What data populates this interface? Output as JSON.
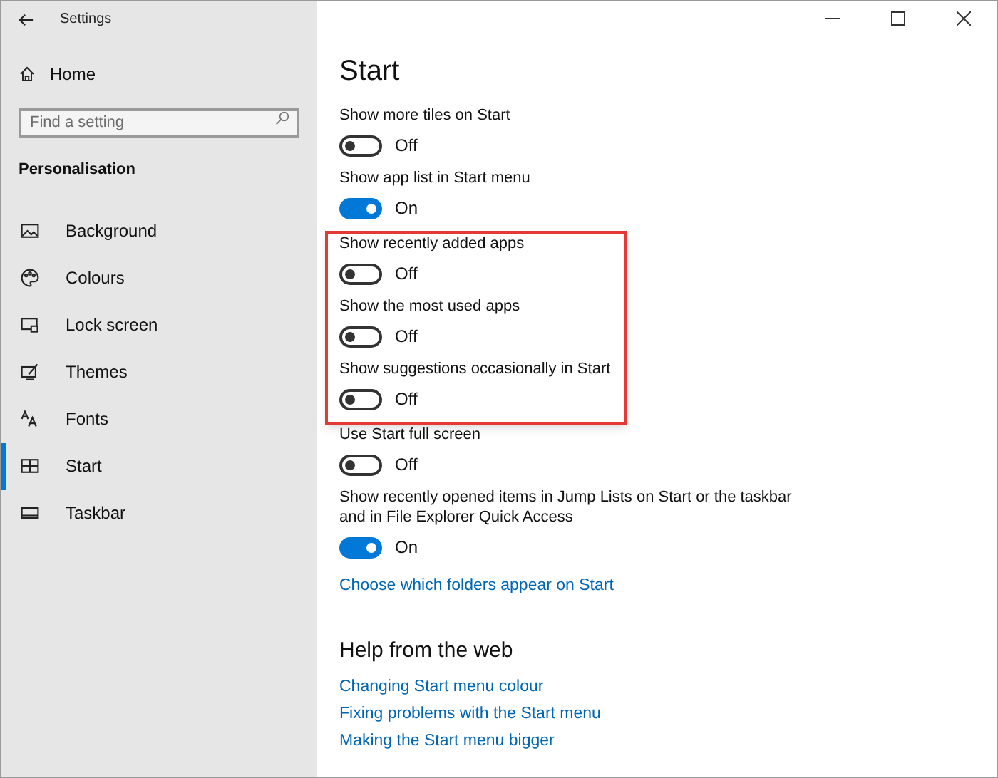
{
  "window": {
    "title": "Settings"
  },
  "sidebar": {
    "home": "Home",
    "search": {
      "placeholder": "Find a setting"
    },
    "section": "Personalisation",
    "items": [
      {
        "label": "Background",
        "selected": false
      },
      {
        "label": "Colours",
        "selected": false
      },
      {
        "label": "Lock screen",
        "selected": false
      },
      {
        "label": "Themes",
        "selected": false
      },
      {
        "label": "Fonts",
        "selected": false
      },
      {
        "label": "Start",
        "selected": true
      },
      {
        "label": "Taskbar",
        "selected": false
      }
    ]
  },
  "page": {
    "title": "Start",
    "settings": [
      {
        "label": "Show more tiles on Start",
        "on": false,
        "state": "Off",
        "highlighted": false
      },
      {
        "label": "Show app list in Start menu",
        "on": true,
        "state": "On",
        "highlighted": false
      },
      {
        "label": "Show recently added apps",
        "on": false,
        "state": "Off",
        "highlighted": true
      },
      {
        "label": "Show the most used apps",
        "on": false,
        "state": "Off",
        "highlighted": true
      },
      {
        "label": "Show suggestions occasionally in Start",
        "on": false,
        "state": "Off",
        "highlighted": true
      },
      {
        "label": "Use Start full screen",
        "on": false,
        "state": "Off",
        "highlighted": false
      },
      {
        "label": "Show recently opened items in Jump Lists on Start or the taskbar and in File Explorer Quick Access",
        "on": true,
        "state": "On",
        "highlighted": false
      }
    ],
    "link": "Choose which folders appear on Start",
    "help": {
      "title": "Help from the web",
      "links": [
        "Changing Start menu colour",
        "Fixing problems with the Start menu",
        "Making the Start menu bigger"
      ]
    }
  }
}
